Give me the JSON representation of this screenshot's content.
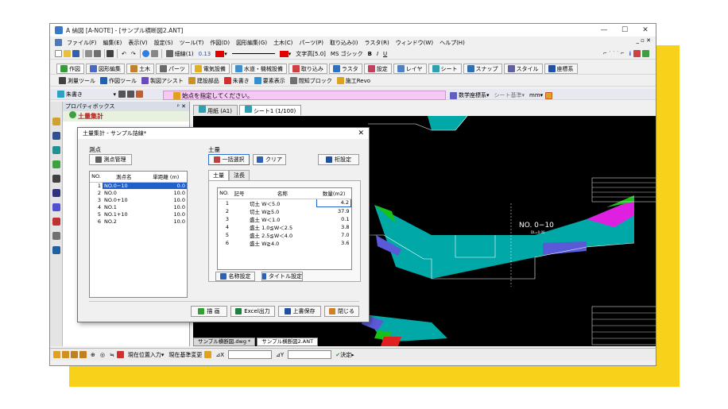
{
  "window": {
    "title": "A 納図 [A-NOTE] - [サンプル横断図2.ANT]",
    "controls": [
      "—",
      "☐",
      "✕"
    ]
  },
  "menu": [
    "ファイル(F)",
    "編集(E)",
    "表示(V)",
    "設定(S)",
    "ツール(T)",
    "作図(D)",
    "図形編集(G)",
    "土木(C)",
    "パーツ(P)",
    "取り込み(I)",
    "ラスタ(R)",
    "ウィンドウ(W)",
    "ヘルプ(H)"
  ],
  "menu_right": "_ ▫ ✕",
  "toolbar1": {
    "line_label": "細線(1)",
    "line_width": "0.13",
    "text_size": "文字高[5.0]",
    "font": "MS ゴシック",
    "bold": "B",
    "italic": "I",
    "underline": "U"
  },
  "toolbar2": [
    "作図",
    "図形編集",
    "土木",
    "パーツ",
    "電気設備",
    "水道・機械設備",
    "取り込み",
    "ラスタ",
    "設定",
    "レイヤ",
    "シート",
    "スナップ",
    "スタイル",
    "座標系"
  ],
  "toolbar3": [
    "測量ツール",
    "作図ツール",
    "製図アシスト",
    "建設部品",
    "朱書き",
    "要素表示",
    "間知ブロック",
    "施工Revo"
  ],
  "toolbar4": {
    "layer": "朱書き",
    "prompt": "始点を指定してください。",
    "coord": "数学座標系",
    "sheet": "シート基準",
    "unit": "mm"
  },
  "property_box": {
    "header": "プロパティボックス",
    "section": "土量集計"
  },
  "cad_tabs": [
    "用紙 (A1)",
    "シート1 (1/100)"
  ],
  "bottom_tabs": [
    "サンプル横断図.dwg *",
    "サンプル横断図2.ANT"
  ],
  "status": {
    "mode": "現在位置入力",
    "base": "現在基準変更",
    "dx": "⊿X",
    "dy": "⊿Y",
    "ok": "決定"
  },
  "cad": {
    "section_label": "NO. 0−10",
    "section_sub": "DL=0.00",
    "colors": {
      "cut": "#00b0b0",
      "fill": "#5a5ad8",
      "green": "#18c018",
      "magenta": "#e020e0",
      "red": "#e02020"
    }
  },
  "dialog": {
    "title": "土量集計 - サンプル詰線*",
    "survey_group": "測点",
    "survey_btn": "測点管理",
    "survey_headers": [
      "NO.",
      "測点名",
      "単距離 (m)"
    ],
    "survey_rows": [
      {
        "no": "1",
        "name": "NO.0−10",
        "dist": "0.0"
      },
      {
        "no": "2",
        "name": "NO.0",
        "dist": "10.0"
      },
      {
        "no": "3",
        "name": "NO.0+10",
        "dist": "10.0"
      },
      {
        "no": "4",
        "name": "NO.1",
        "dist": "10.0"
      },
      {
        "no": "5",
        "name": "NO.1+10",
        "dist": "10.0"
      },
      {
        "no": "6",
        "name": "NO.2",
        "dist": "10.0"
      }
    ],
    "volume_group": "土量",
    "batch_btn": "一括選択",
    "clear_btn": "クリア",
    "digits_btn": "桁設定",
    "tabs": [
      "土量",
      "法長"
    ],
    "volume_headers": [
      "NO.",
      "記号",
      "名称",
      "数量(m2)"
    ],
    "volume_rows": [
      {
        "no": "1",
        "sym": "",
        "name": "切土 W＜5.0",
        "qty": "4.2"
      },
      {
        "no": "2",
        "sym": "",
        "name": "切土 W≧5.0",
        "qty": "37.9"
      },
      {
        "no": "3",
        "sym": "",
        "name": "盛土 W＜1.0",
        "qty": "0.1"
      },
      {
        "no": "4",
        "sym": "",
        "name": "盛土 1.0≦W＜2.5",
        "qty": "3.8"
      },
      {
        "no": "5",
        "sym": "",
        "name": "盛土 2.5≦W＜4.0",
        "qty": "7.0"
      },
      {
        "no": "6",
        "sym": "",
        "name": "盛土 W≧4.0",
        "qty": "3.6"
      }
    ],
    "name_setting_btn": "名称設定",
    "title_setting_btn": "タイトル設定",
    "draw_btn": "描 画",
    "excel_btn": "Excel出力",
    "save_btn": "上書保存",
    "close_btn": "閉じる"
  }
}
